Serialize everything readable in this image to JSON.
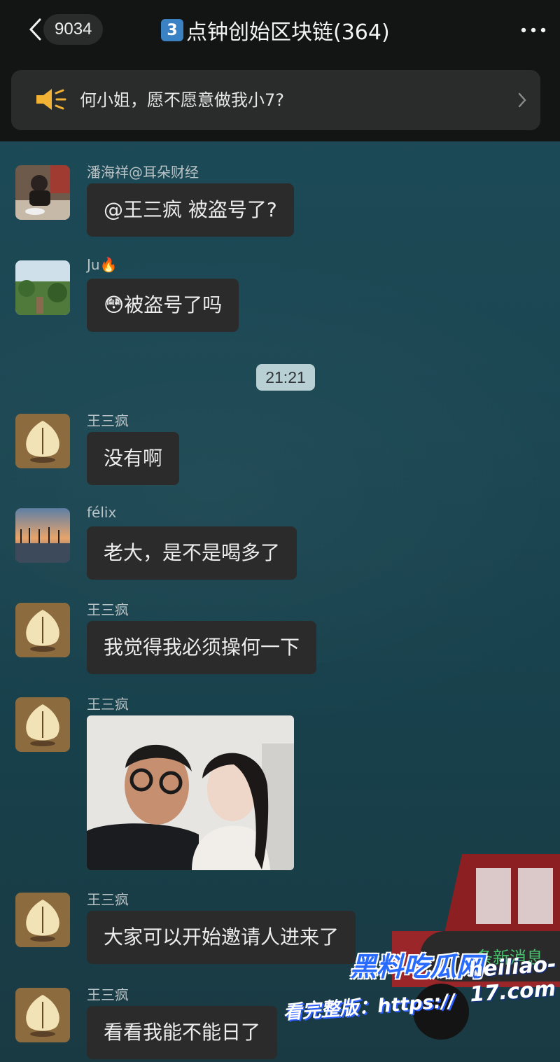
{
  "header": {
    "back_count": "9034",
    "title_badge": "3",
    "title": "点钟创始区块链(364)"
  },
  "notice": {
    "text": "何小姐，愿不愿意做我小7?"
  },
  "messages": [
    {
      "sender": "潘海祥@耳朵财经",
      "text": "@王三疯 被盗号了?"
    },
    {
      "sender": "Ju🔥",
      "text": "😳被盗号了吗"
    },
    {
      "sender": "王三疯",
      "text": "没有啊"
    },
    {
      "sender": "félix",
      "text": "老大，是不是喝多了"
    },
    {
      "sender": "王三疯",
      "text": "我觉得我必须操何一下"
    },
    {
      "sender": "王三疯"
    },
    {
      "sender": "王三疯",
      "text": "大家可以开始邀请人进来了"
    },
    {
      "sender": "王三疯",
      "text": "看看我能不能日了"
    }
  ],
  "timestamp": "21:21",
  "new_messages": "条新消息",
  "watermark": {
    "brand": "黑料吃瓜网",
    "url": "heiliao-17.com",
    "tagline": "看完整版：https://"
  },
  "colors": {
    "accent_green": "#47c16e",
    "bubble": "#2b2b2b",
    "chat_background": "#1a4652"
  }
}
